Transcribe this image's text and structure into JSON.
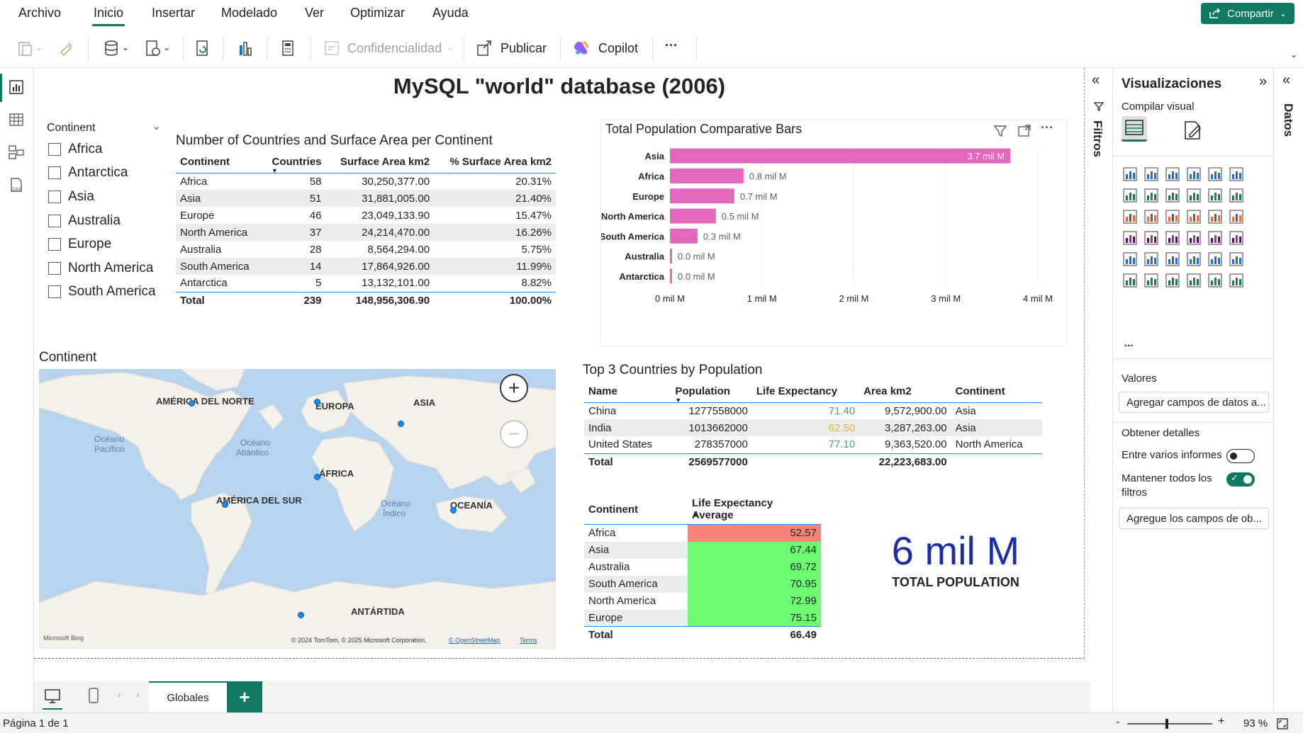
{
  "menu": {
    "items": [
      "Archivo",
      "Inicio",
      "Insertar",
      "Modelado",
      "Ver",
      "Optimizar",
      "Ayuda"
    ],
    "active": "Inicio",
    "share_label": "Compartir"
  },
  "toolbar": {
    "confidentiality_label": "Confidencialidad",
    "publish_label": "Publicar",
    "copilot_label": "Copilot",
    "more_label": "···"
  },
  "report": {
    "title": "MySQL \"world\" database (2006)"
  },
  "slicer": {
    "title": "Continent",
    "items": [
      "Africa",
      "Antarctica",
      "Asia",
      "Australia",
      "Europe",
      "North America",
      "South America"
    ]
  },
  "continent_table": {
    "title": "Number of Countries and Surface Area per Continent",
    "headers": [
      "Continent",
      "Countries",
      "Surface Area km2",
      "% Surface Area km2"
    ],
    "rows": [
      [
        "Africa",
        "58",
        "30,250,377.00",
        "20.31%"
      ],
      [
        "Asia",
        "51",
        "31,881,005.00",
        "21.40%"
      ],
      [
        "Europe",
        "46",
        "23,049,133.90",
        "15.47%"
      ],
      [
        "North America",
        "37",
        "24,214,470.00",
        "16.26%"
      ],
      [
        "Australia",
        "28",
        "8,564,294.00",
        "5.75%"
      ],
      [
        "South America",
        "14",
        "17,864,926.00",
        "11.99%"
      ],
      [
        "Antarctica",
        "5",
        "13,132,101.00",
        "8.82%"
      ]
    ],
    "total": [
      "Total",
      "239",
      "148,956,306.90",
      "100.00%"
    ]
  },
  "chart_data": {
    "type": "bar",
    "title": "Total Population Comparative Bars",
    "orientation": "horizontal",
    "categories": [
      "Asia",
      "Africa",
      "Europe",
      "North America",
      "South America",
      "Australia",
      "Antarctica"
    ],
    "values": [
      3.7,
      0.8,
      0.7,
      0.5,
      0.3,
      0.0,
      0.0
    ],
    "data_labels": [
      "3.7 mil M",
      "0.8 mil M",
      "0.7 mil M",
      "0.5 mil M",
      "0.3 mil M",
      "0.0 mil M",
      "0.0 mil M"
    ],
    "x_ticks": [
      "0 mil M",
      "1 mil M",
      "2 mil M",
      "3 mil M",
      "4 mil M"
    ],
    "xlim": [
      0,
      4
    ],
    "bar_color": "#e467be",
    "grid": true
  },
  "map": {
    "title": "Continent",
    "labels": {
      "north_america": "AMÉRICA DEL NORTE",
      "europe": "EUROPA",
      "asia": "ASIA",
      "africa": "ÁFRICA",
      "south_america": "AMÉRICA DEL SUR",
      "oceania": "OCEANÍA",
      "antarctica": "ANTÁRTIDA",
      "pacific_1": "Océano",
      "pacific_2": "Pacífico",
      "atlantic_1": "Océano",
      "atlantic_2": "Atlántico",
      "indian_1": "Océano",
      "indian_2": "Índico"
    },
    "bing": "Microsoft Bing",
    "attribution": "© 2024 TomTom, © 2025 Microsoft Corporation,",
    "osm": "© OpenStreetMap",
    "terms": "Terms",
    "zoom_in": "+",
    "zoom_out": "−"
  },
  "top3_table": {
    "title": "Top 3 Countries by Population",
    "headers": [
      "Name",
      "Population",
      "Life Expectancy",
      "Area km2",
      "Continent"
    ],
    "rows": [
      [
        "China",
        "1277558000",
        "71.40",
        "9,572,900.00",
        "Asia"
      ],
      [
        "India",
        "1013662000",
        "62.50",
        "3,287,263.00",
        "Asia"
      ],
      [
        "United States",
        "278357000",
        "77.10",
        "9,363,520.00",
        "North America"
      ]
    ],
    "life_colors": [
      "#4aa564",
      "#d8b243",
      "#4aa564"
    ],
    "total": [
      "Total",
      "2569577000",
      "",
      "22,223,683.00",
      ""
    ]
  },
  "life_table": {
    "headers": [
      "Continent",
      "Life Expectancy Average"
    ],
    "rows": [
      [
        "Africa",
        "52.57",
        "#f88379"
      ],
      [
        "Asia",
        "67.44",
        "#6cfb73"
      ],
      [
        "Australia",
        "69.72",
        "#6cfb73"
      ],
      [
        "South America",
        "70.95",
        "#6cfb73"
      ],
      [
        "North America",
        "72.99",
        "#6cfb73"
      ],
      [
        "Europe",
        "75.15",
        "#6cfb73"
      ]
    ],
    "total": [
      "Total",
      "66.49"
    ]
  },
  "card": {
    "value": "6 mil M",
    "label": "TOTAL POPULATION",
    "color": "#1a2ea6"
  },
  "filters_pane": {
    "label": "Filtros"
  },
  "viz_pane": {
    "title": "Visualizaciones",
    "build_label": "Compilar visual",
    "more": "...",
    "values_label": "Valores",
    "values_placeholder": "Agregar campos de datos a...",
    "drillthrough_label": "Obtener detalles",
    "cross_report_label": "Entre varios informes",
    "keep_filters_label_1": "Mantener todos los",
    "keep_filters_label_2": "filtros",
    "drill_placeholder": "Agregue los campos de ob..."
  },
  "data_pane": {
    "label": "Datos"
  },
  "page_tabs": {
    "active_tab": "Globales",
    "add": "+"
  },
  "status": {
    "page": "Página 1 de 1",
    "zoom": "93 %",
    "minus": "-",
    "plus": "+"
  },
  "colors": {
    "accent": "#117865",
    "table_line": "#118dff"
  }
}
